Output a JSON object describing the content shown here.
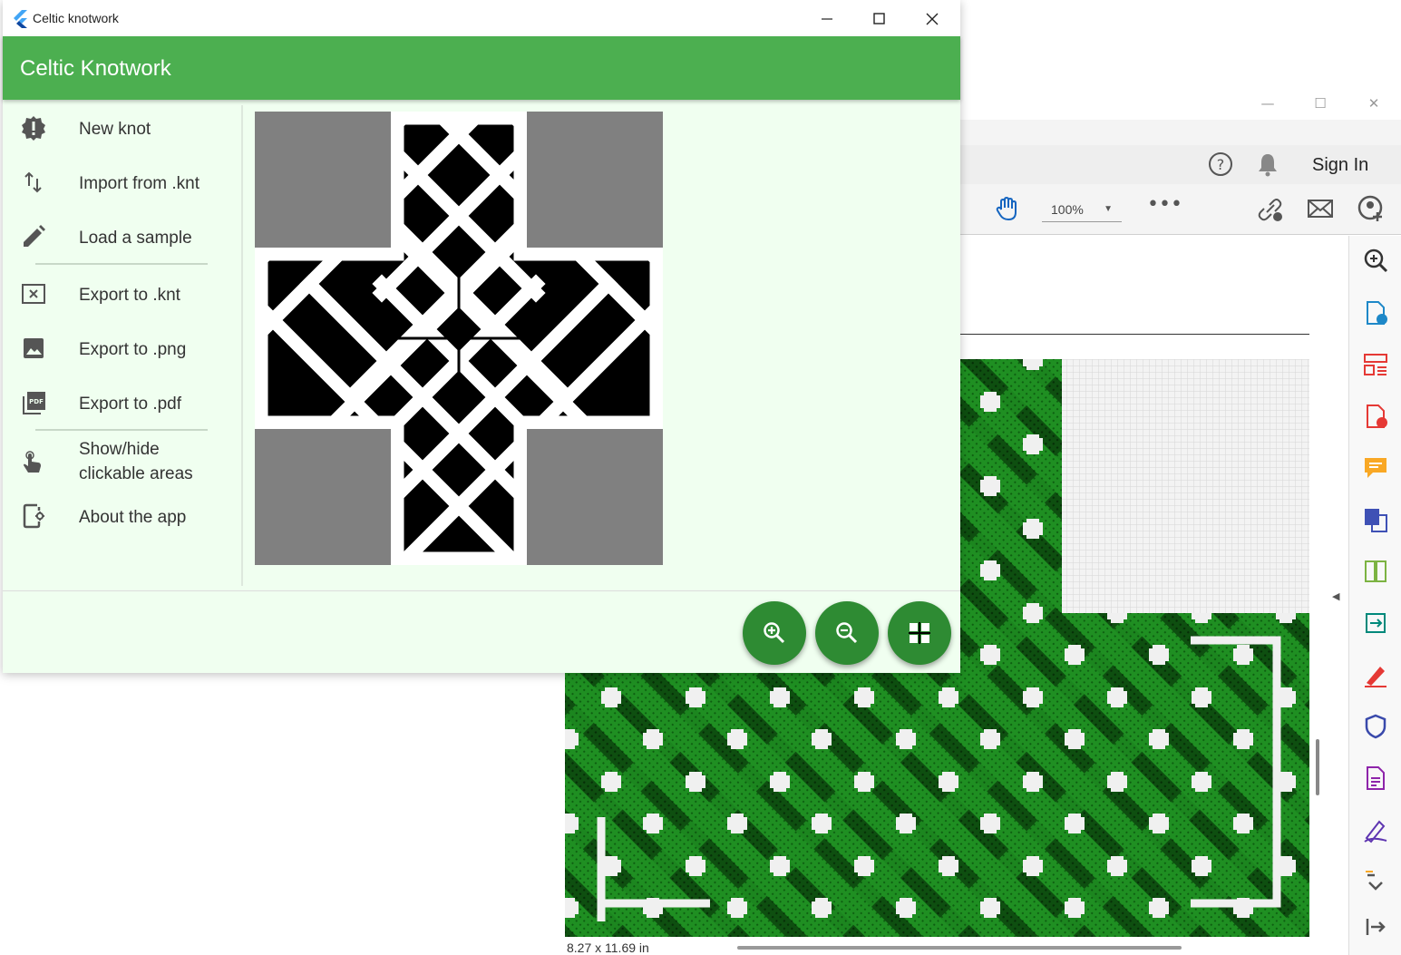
{
  "window": {
    "title": "Celtic knotwork"
  },
  "appbar": {
    "title": "Celtic Knotwork"
  },
  "menu": {
    "items": [
      {
        "label": "New knot",
        "icon": "new-knot-icon"
      },
      {
        "label": "Import from .knt",
        "icon": "import-arrows-icon"
      },
      {
        "label": "Load a sample",
        "icon": "pencil-icon"
      },
      {
        "label": "Export to .knt",
        "icon": "export-knt-icon"
      },
      {
        "label": "Export to .png",
        "icon": "image-icon"
      },
      {
        "label": "Export to .pdf",
        "icon": "pdf-icon"
      },
      {
        "label": "Show/hide\nclickable areas",
        "icon": "touch-icon"
      },
      {
        "label": "About the app",
        "icon": "app-info-icon"
      }
    ]
  },
  "fabs": [
    {
      "name": "zoom-in",
      "icon": "zoom-in-icon"
    },
    {
      "name": "zoom-out",
      "icon": "zoom-out-icon"
    },
    {
      "name": "fit",
      "icon": "grid-fit-icon"
    }
  ],
  "pdf_viewer": {
    "sign_in": "Sign In",
    "zoom": "100%",
    "page_size": "8.27 x 11.69 in"
  },
  "colors": {
    "appbar": "#4caf50",
    "fab": "#2e8b33",
    "app_background": "#f0fff0",
    "knot_background": "#808080",
    "pattern_green": "#1f8f22"
  }
}
